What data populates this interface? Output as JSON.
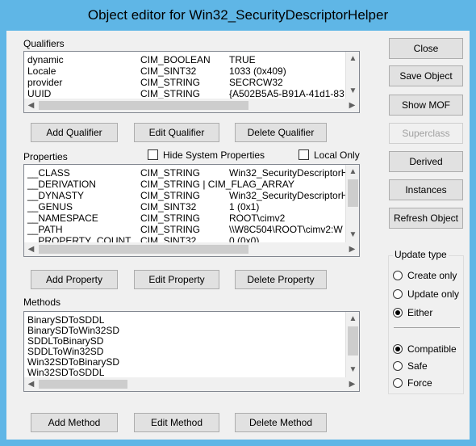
{
  "window": {
    "title": "Object editor for Win32_SecurityDescriptorHelper"
  },
  "qualifiers": {
    "label": "Qualifiers",
    "rows": [
      {
        "name": "dynamic",
        "type": "CIM_BOOLEAN",
        "value": "TRUE"
      },
      {
        "name": "Locale",
        "type": "CIM_SINT32",
        "value": "1033 (0x409)"
      },
      {
        "name": "provider",
        "type": "CIM_STRING",
        "value": "SECRCW32"
      },
      {
        "name": "UUID",
        "type": "CIM_STRING",
        "value": "{A502B5A5-B91A-41d1-83"
      }
    ],
    "add_label": "Add Qualifier",
    "edit_label": "Edit Qualifier",
    "delete_label": "Delete Qualifier"
  },
  "properties": {
    "label": "Properties",
    "hide_system_label": "Hide System Properties",
    "local_only_label": "Local Only",
    "rows": [
      {
        "name": "__CLASS",
        "type": "CIM_STRING",
        "value": "Win32_SecurityDescriptorH"
      },
      {
        "name": "__DERIVATION",
        "type": "CIM_STRING | CIM_FLAG_ARRAY",
        "value": ""
      },
      {
        "name": "__DYNASTY",
        "type": "CIM_STRING",
        "value": "Win32_SecurityDescriptorH"
      },
      {
        "name": "__GENUS",
        "type": "CIM_SINT32",
        "value": "1 (0x1)"
      },
      {
        "name": "__NAMESPACE",
        "type": "CIM_STRING",
        "value": "ROOT\\cimv2"
      },
      {
        "name": "__PATH",
        "type": "CIM_STRING",
        "value": "\\\\W8C504\\ROOT\\cimv2:W"
      },
      {
        "name": "__PROPERTY_COUNT",
        "type": "CIM_SINT32",
        "value": "0 (0x0)"
      }
    ],
    "add_label": "Add Property",
    "edit_label": "Edit Property",
    "delete_label": "Delete Property"
  },
  "methods": {
    "label": "Methods",
    "rows": [
      {
        "name": "BinarySDToSDDL"
      },
      {
        "name": "BinarySDToWin32SD"
      },
      {
        "name": "SDDLToBinarySD"
      },
      {
        "name": "SDDLToWin32SD"
      },
      {
        "name": "Win32SDToBinarySD"
      },
      {
        "name": "Win32SDToSDDL"
      }
    ],
    "add_label": "Add Method",
    "edit_label": "Edit Method",
    "delete_label": "Delete Method"
  },
  "side_buttons": {
    "close": "Close",
    "save_object": "Save Object",
    "show_mof": "Show MOF",
    "superclass": "Superclass",
    "derived": "Derived",
    "instances": "Instances",
    "refresh_object": "Refresh Object"
  },
  "update_type": {
    "label": "Update type",
    "create_only": "Create only",
    "update_only": "Update only",
    "either": "Either",
    "compatible": "Compatible",
    "safe": "Safe",
    "force": "Force"
  },
  "icons": {
    "scroll_up": "scroll-up-arrow-icon",
    "scroll_down": "scroll-down-arrow-icon",
    "scroll_left": "scroll-left-arrow-icon",
    "scroll_right": "scroll-right-arrow-icon"
  }
}
